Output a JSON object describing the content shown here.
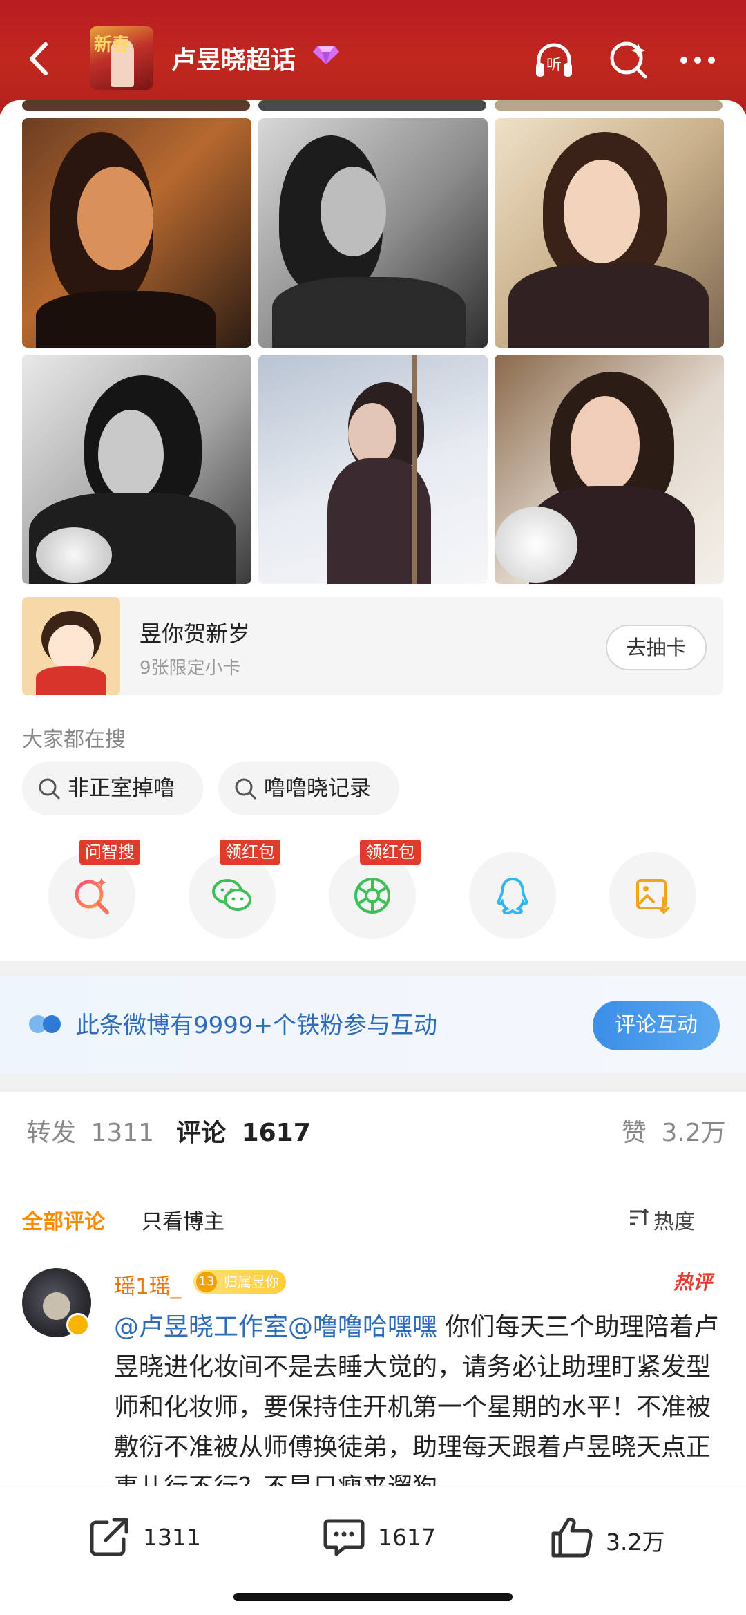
{
  "header": {
    "title": "卢昱晓超话",
    "avatar_text": "新春",
    "icons": [
      "back-icon",
      "listen-icon",
      "search-icon",
      "more-icon"
    ],
    "listen_label": "听"
  },
  "photos": [
    {
      "tone": "warm-orange"
    },
    {
      "tone": "grayscale"
    },
    {
      "tone": "warm-light"
    },
    {
      "tone": "grayscale-snow"
    },
    {
      "tone": "snow-swing"
    },
    {
      "tone": "snow-warm"
    }
  ],
  "promo": {
    "title": "昱你贺新岁",
    "subtitle": "9张限定小卡",
    "button": "去抽卡"
  },
  "search": {
    "label": "大家都在搜",
    "chips": [
      "非正室掉噜",
      "噜噜晓记录"
    ]
  },
  "share_targets": [
    {
      "name": "wenzhisou",
      "badge": "问智搜"
    },
    {
      "name": "wechat",
      "badge": "领红包"
    },
    {
      "name": "moments",
      "badge": "领红包"
    },
    {
      "name": "qq",
      "badge": ""
    },
    {
      "name": "save-image",
      "badge": ""
    }
  ],
  "fans_banner": {
    "text": "此条微博有9999+个铁粉参与互动",
    "button": "评论互动"
  },
  "tabs": {
    "repost_label": "转发",
    "repost_count": "1311",
    "comment_label": "评论",
    "comment_count": "1617",
    "like_label": "赞",
    "like_count": "3.2万"
  },
  "filters": {
    "all": "全部评论",
    "author_only": "只看博主",
    "sort": "热度"
  },
  "comment": {
    "username": "瑶1瑶_",
    "fan_level": "13",
    "fan_badge": "归属昱你",
    "hot_label": "热评",
    "mention1": "@卢昱晓工作室",
    "mention2": "@噜噜哈嘿嘿",
    "text": " 你们每天三个助理陪着卢昱晓进化妆间不是去睡大觉的，请务必让助理盯紧发型师和化妆师，要保持住开机第一个星期的水平！不准被敷衍不准被从师傅换徒弟，助理每天跟着卢昱晓天点正事儿行不行？不是只瘦来遛狗"
  },
  "bottom_bar": {
    "repost": "1311",
    "comment": "1617",
    "like": "3.2万"
  },
  "colors": {
    "header_red": "#b81d21",
    "accent_orange": "#ff8a00",
    "link_blue": "#2e6bb8",
    "badge_red": "#e03c2c"
  }
}
